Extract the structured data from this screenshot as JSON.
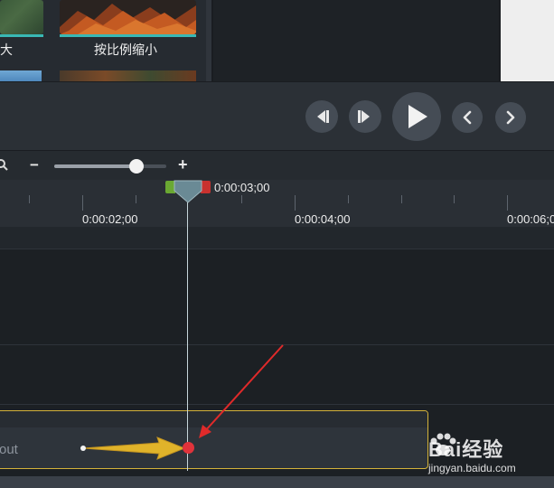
{
  "library": {
    "thumb_left_label": "大",
    "thumb_right_label": "按比例缩小"
  },
  "playback": {
    "buttons": [
      "step-back",
      "step-forward",
      "play",
      "previous",
      "next"
    ]
  },
  "zoom": {
    "minus_label": "−",
    "plus_label": "+",
    "level": 0.74
  },
  "ruler": {
    "playhead_time": "0:00:03;00",
    "labels": [
      "0:00:02;00",
      "0:00:04;00",
      "0:00:06;0"
    ]
  },
  "clip": {
    "text": "out"
  },
  "watermark": {
    "brand": "Bai经验",
    "url": "jingyan.baidu.com"
  },
  "colors": {
    "accent_teal": "#39b8b4",
    "clip_border": "#d4b23a",
    "arrow_fill": "#e0b32a",
    "marker_red": "#e0333b",
    "annotation_red": "#e02a2a",
    "in_marker_green": "#6aa832",
    "out_marker_red": "#c8322f",
    "playhead": "#6a8a95"
  }
}
